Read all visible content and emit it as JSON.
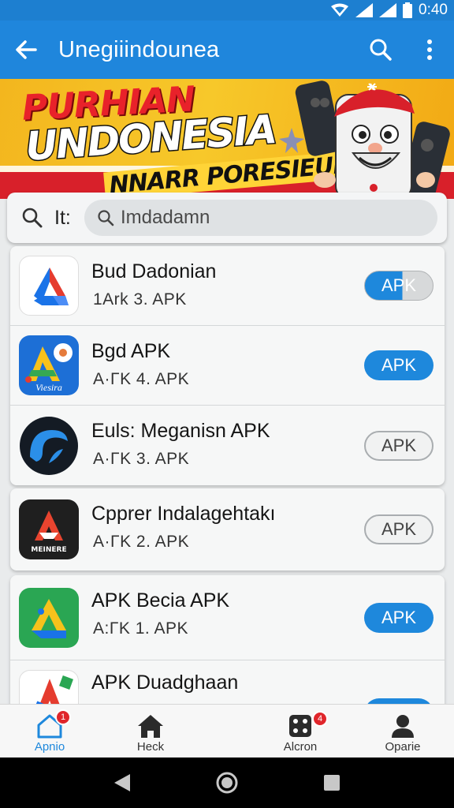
{
  "status_bar": {
    "time": "0:40"
  },
  "app_bar": {
    "title": "Unegiiindounea",
    "back_icon": "arrow-back-icon",
    "search_icon": "search-icon",
    "more_icon": "more-vert-icon"
  },
  "banner": {
    "line1": "PURHIAN",
    "line2": "UNDONESIA",
    "line3": "NNARR PORESIEUN!"
  },
  "search": {
    "prefix": "It:",
    "placeholder": "Imdadamn"
  },
  "apps": [
    {
      "name": "Bud Dadonian",
      "meta": "1Ark  3. APK",
      "button": "APK",
      "button_style": "half"
    },
    {
      "name": "Bgd APK",
      "meta": "A·ΓK  4. APK",
      "button": "APK",
      "button_style": "filled",
      "icon_text": "Viesira"
    },
    {
      "name": "Euls: Meganisn APK",
      "meta": "A·ΓK  3. APK",
      "button": "APK",
      "button_style": "outline"
    },
    {
      "name": "Cpprer Indalagehtakı",
      "meta": "A·ΓK  2. APK",
      "button": "APK",
      "button_style": "outline",
      "icon_text": "MEINERE"
    },
    {
      "name": "APK Becia APK",
      "meta": "A:ΓK  1. APK",
      "button": "APK",
      "button_style": "filled"
    },
    {
      "name": "APK Duadghaan",
      "meta": "",
      "button": "APK",
      "button_style": "filled"
    }
  ],
  "bottom_nav": [
    {
      "label": "Apnio",
      "icon": "home-outline-icon",
      "badge": "1",
      "active": true
    },
    {
      "label": "Heck",
      "icon": "home-filled-icon",
      "badge": "",
      "active": false
    },
    {
      "label": "Alcron",
      "icon": "dice-icon",
      "badge": "4",
      "active": false
    },
    {
      "label": "Oparie",
      "icon": "person-icon",
      "badge": "",
      "active": false
    }
  ],
  "colors": {
    "primary": "#1f86dc",
    "badge": "#e0262b",
    "banner_yellow": "#f7c82a",
    "banner_red": "#d8202a"
  }
}
